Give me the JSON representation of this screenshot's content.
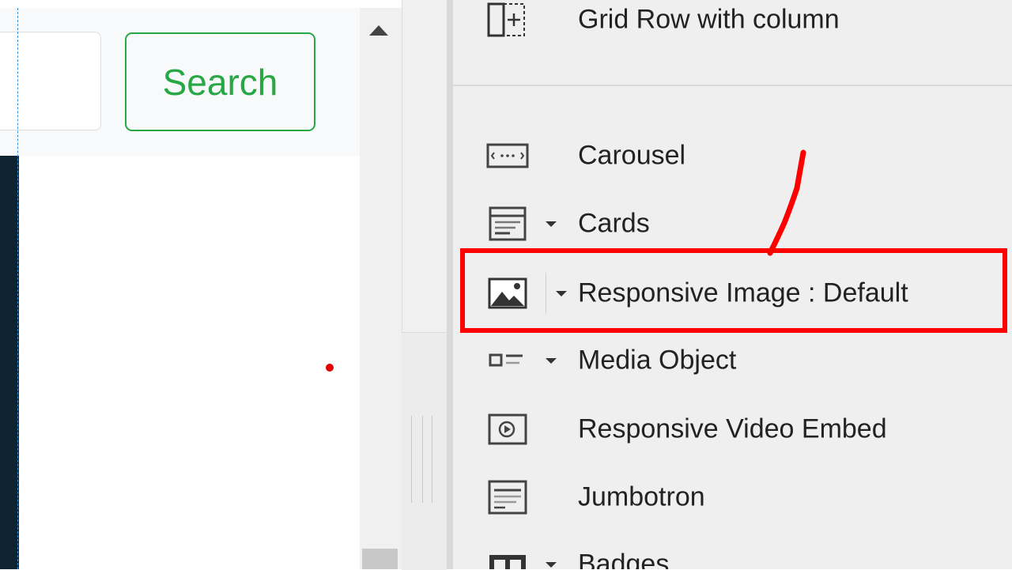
{
  "canvas": {
    "search_button_label": "Search"
  },
  "components": {
    "items": [
      {
        "label": "Grid Row with column",
        "icon": "grid-row-icon"
      },
      {
        "label": "Carousel",
        "icon": "carousel-icon"
      },
      {
        "label": "Cards",
        "icon": "card-icon"
      },
      {
        "label": "Responsive Image : Default",
        "icon": "image-icon"
      },
      {
        "label": "Media Object",
        "icon": "media-object-icon"
      },
      {
        "label": "Responsive Video Embed",
        "icon": "video-embed-icon"
      },
      {
        "label": "Jumbotron",
        "icon": "jumbotron-icon"
      },
      {
        "label": "Badges",
        "icon": "badges-icon"
      }
    ],
    "selected_index": 3
  },
  "colors": {
    "accent_green": "#28a745",
    "highlight_red": "#ff0000",
    "panel_bg": "#efefef"
  }
}
